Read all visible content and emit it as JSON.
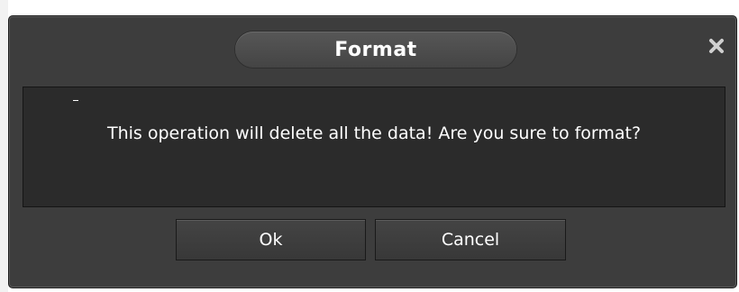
{
  "dialog": {
    "title": "Format",
    "message": "This operation will delete all the data! Are you sure to format?",
    "buttons": {
      "ok_label": "Ok",
      "cancel_label": "Cancel"
    },
    "close_icon": "close-icon"
  },
  "colors": {
    "dialog_background": "#3d3d3d",
    "panel_background": "#2b2b2b",
    "text": "#ffffff"
  }
}
